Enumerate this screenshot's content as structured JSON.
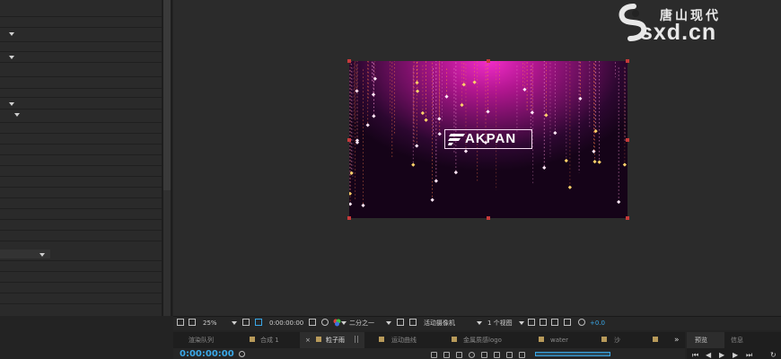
{
  "viewer": {
    "logo_text": "AKPAN"
  },
  "watermark": {
    "cn": "唐山现代",
    "en": "sxd.cn"
  },
  "toolbar": {
    "zoom": "25%",
    "timecode": "0:00:00:00",
    "resolution": "二分之一",
    "camera": "活动摄像机",
    "views": "1 个视图",
    "exposure": "+0.0"
  },
  "timeline": {
    "tabs": [
      {
        "label": "渲染队列"
      },
      {
        "label": "合成 1"
      },
      {
        "label": "粒子雨"
      },
      {
        "label": "运动曲线"
      },
      {
        "label": "金属质感logo"
      },
      {
        "label": "water"
      },
      {
        "label": "沙"
      }
    ],
    "current_time": "0:00:00:00"
  },
  "right_panel": {
    "tabs": [
      {
        "label": "预览"
      },
      {
        "label": "信息"
      }
    ]
  },
  "colors": {
    "accent": "#3aa8e8",
    "comp_center": "#f02cc8",
    "handle": "#c63a3a"
  }
}
